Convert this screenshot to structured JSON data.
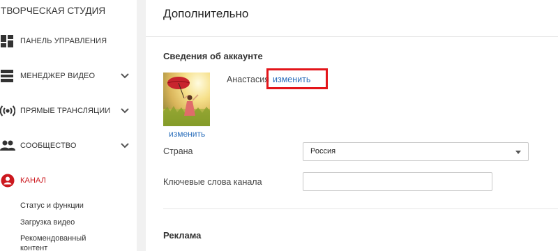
{
  "sidebar": {
    "brand": "ТВОРЧЕСКАЯ СТУДИЯ",
    "items": [
      {
        "label": "ПАНЕЛЬ УПРАВЛЕНИЯ",
        "icon": "dashboard-icon",
        "expandable": false,
        "active": false
      },
      {
        "label": "МЕНЕДЖЕР ВИДЕО",
        "icon": "video-manager-icon",
        "expandable": true,
        "active": false
      },
      {
        "label": "ПРЯМЫЕ ТРАНСЛЯЦИИ",
        "icon": "live-broadcast-icon",
        "expandable": true,
        "active": false
      },
      {
        "label": "СООБЩЕСТВО",
        "icon": "community-icon",
        "expandable": true,
        "active": false
      },
      {
        "label": "КАНАЛ",
        "icon": "channel-icon",
        "expandable": false,
        "active": true
      }
    ],
    "sub_items": [
      {
        "label": "Статус и функции"
      },
      {
        "label": "Загрузка видео"
      },
      {
        "label": "Рекомендованный"
      },
      {
        "label": "контент"
      }
    ],
    "active_color": "#cc181e"
  },
  "main": {
    "title": "Дополнительно",
    "account_section": {
      "title": "Сведения об аккаунте",
      "name": "Анастасия",
      "name_change_link": "изменить",
      "avatar_change_link": "изменить"
    },
    "country": {
      "label": "Страна",
      "value": "Россия"
    },
    "keywords": {
      "label": "Ключевые слова канала",
      "value": ""
    },
    "ads_section": {
      "title": "Реклама"
    }
  },
  "colors": {
    "link": "#2a6ebb",
    "highlight": "#e3151a",
    "sidebar_divider": "#f1f1f1"
  }
}
